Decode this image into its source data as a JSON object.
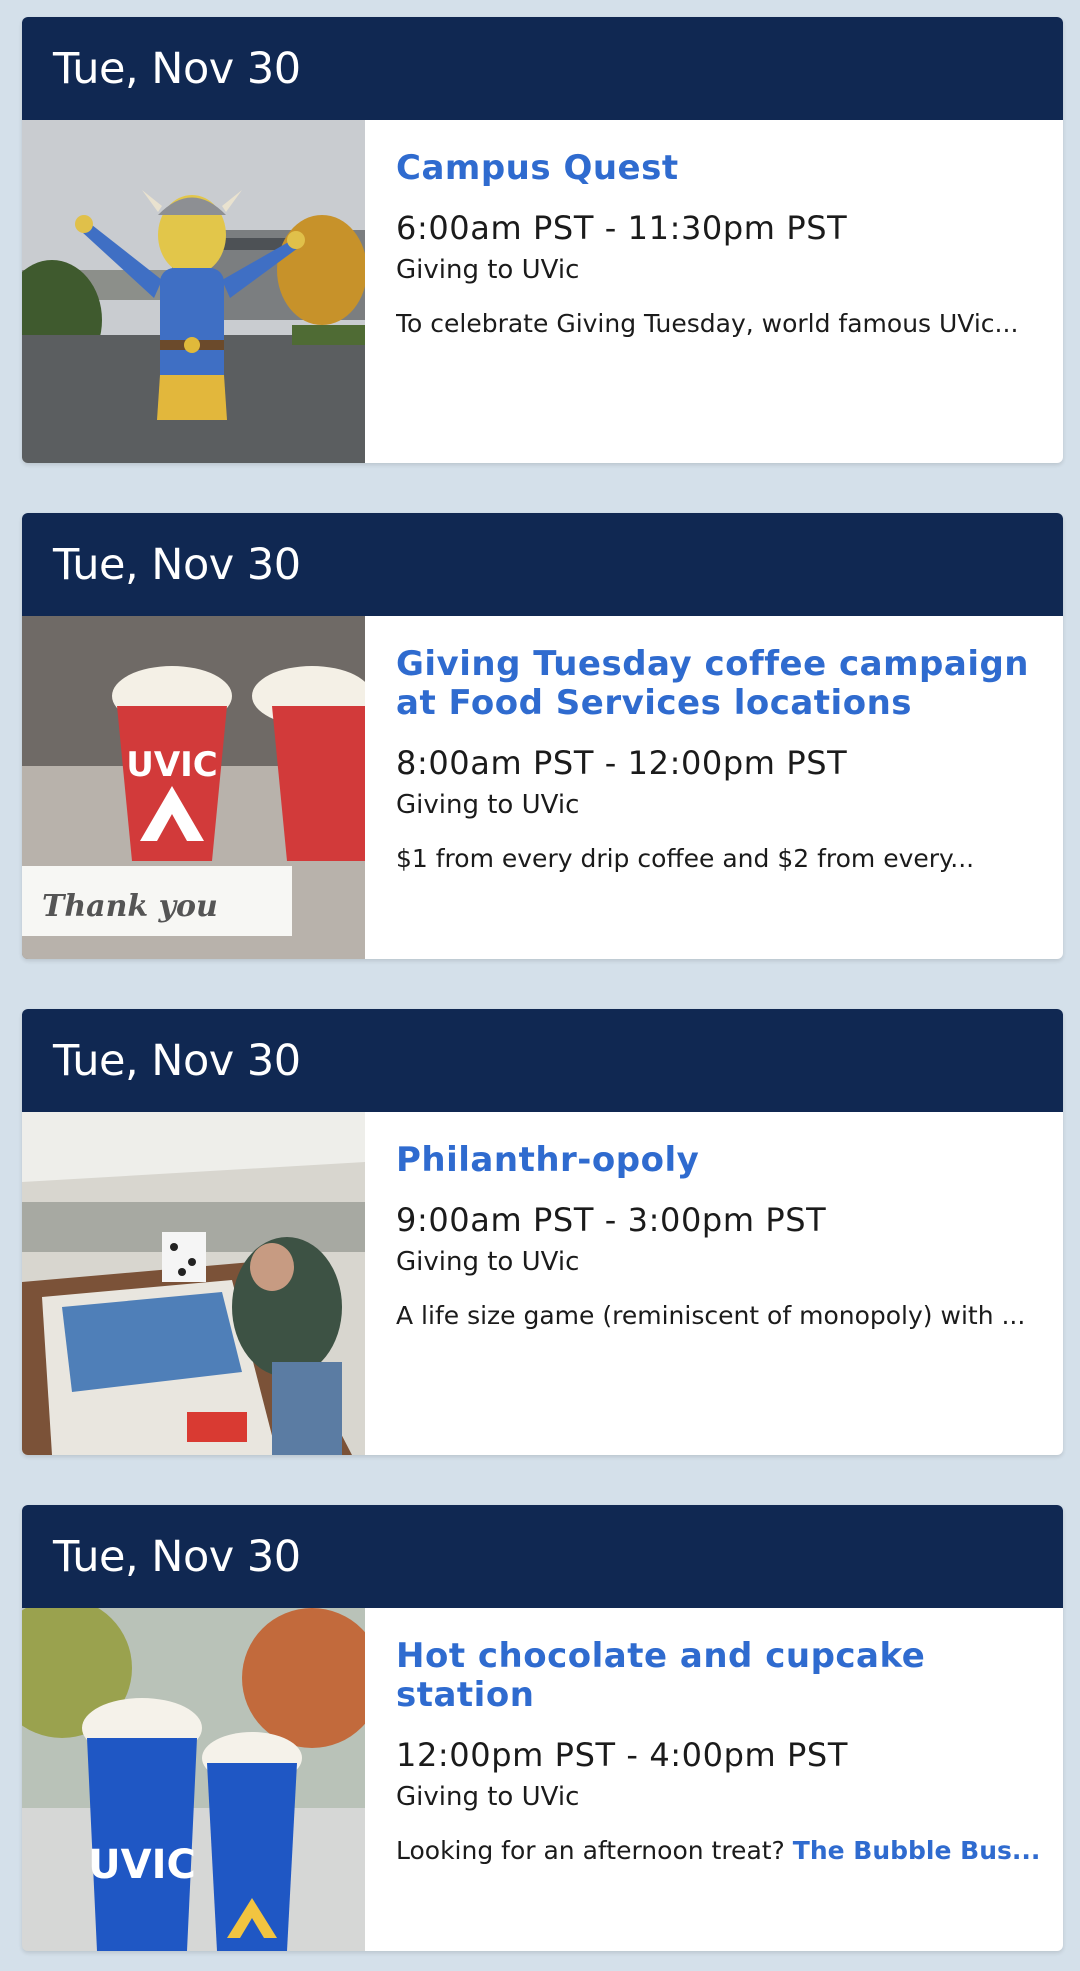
{
  "events": [
    {
      "date": "Tue, Nov 30",
      "title": "Campus Quest",
      "time": "6:00am PST - 11:30pm PST",
      "category": "Giving to UVic",
      "description": "To celebrate Giving Tuesday, world famous UVic..."
    },
    {
      "date": "Tue, Nov 30",
      "title": "Giving Tuesday coffee campaign at Food Services locations",
      "time": "8:00am PST - 12:00pm PST",
      "category": "Giving to UVic",
      "description": "$1 from every drip coffee and $2 from every..."
    },
    {
      "date": "Tue, Nov 30",
      "title": "Philanthr-opoly",
      "time": "9:00am PST - 3:00pm PST",
      "category": "Giving to UVic",
      "description": "A life size game (reminiscent of monopoly) with ..."
    },
    {
      "date": "Tue, Nov 30",
      "title": "Hot chocolate and cupcake station",
      "time": "12:00pm PST - 4:00pm PST",
      "category": "Giving to UVic",
      "description": "Looking for an afternoon treat? ",
      "description_link": "The Bubble Bus..."
    }
  ],
  "image_text": {
    "cup_logo": "UVIC",
    "card_text": "Thank you"
  },
  "colors": {
    "page_background": "#d4e0ea",
    "header_background": "#102852",
    "title_link": "#2f6bcf"
  }
}
